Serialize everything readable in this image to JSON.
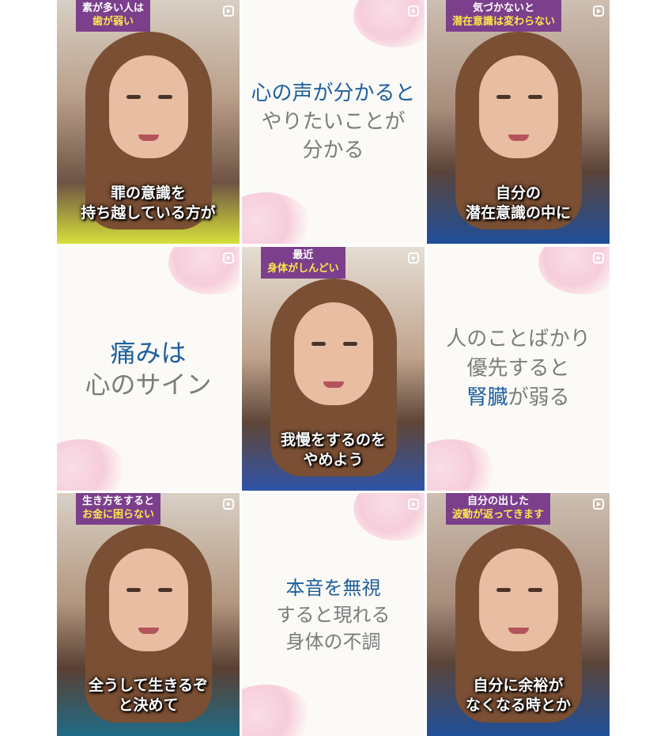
{
  "tiles": [
    {
      "kind": "video",
      "tag": {
        "line1": "素が多い人は",
        "line2": "歯が弱い"
      },
      "caption": {
        "line1": "罪の意識を",
        "line2": "持ち越している方が"
      }
    },
    {
      "kind": "text",
      "lines": [
        "心の声が分かると",
        "やりたいことが",
        "分かる"
      ]
    },
    {
      "kind": "video",
      "tag": {
        "line1": "気づかないと",
        "line2": "潜在意識は変わらない"
      },
      "caption": {
        "line1": "自分の",
        "line2": "潜在意識の中に"
      }
    },
    {
      "kind": "text",
      "lines": [
        "痛みは",
        "心のサイン"
      ]
    },
    {
      "kind": "video",
      "tag": {
        "line1": "最近",
        "line2": "身体がしんどい"
      },
      "caption": {
        "line1": "我慢をするのを",
        "line2": "やめよう"
      }
    },
    {
      "kind": "text",
      "lines": [
        "人のことばかり",
        "優先すると",
        "腎臓が弱る"
      ]
    },
    {
      "kind": "video",
      "tag": {
        "line1": "生き方をすると",
        "line2": "お金に困らない"
      },
      "caption": {
        "line1": "全うして生きるぞ",
        "line2": "と決めて"
      }
    },
    {
      "kind": "text",
      "lines": [
        "本音を無視",
        "すると現れる",
        "身体の不調"
      ]
    },
    {
      "kind": "video",
      "tag": {
        "line1": "自分の出した",
        "line2": "波動が返ってきます"
      },
      "caption": {
        "line1": "自分に余裕が",
        "line2": "なくなる時とか"
      }
    }
  ],
  "icons": {
    "reel": "reels-icon"
  },
  "colors": {
    "accent_text": "#1f5f9e",
    "muted_text": "#7c7c7c",
    "tag_bg": "#7b3f8c",
    "tag_text": "#ffe54a"
  }
}
